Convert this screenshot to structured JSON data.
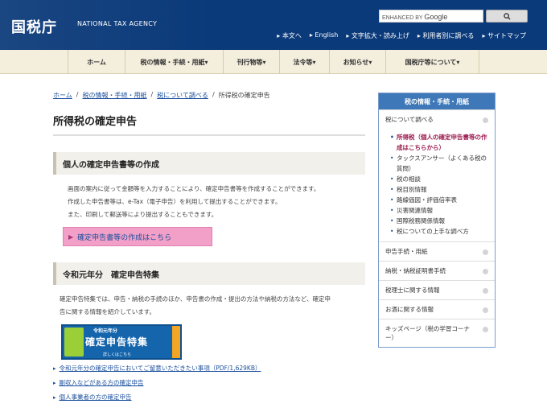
{
  "header": {
    "logo": "国税庁",
    "agency_en": "NATIONAL TAX AGENCY",
    "search_prefix": "ENHANCED BY",
    "search_brand": "Google",
    "util_links": [
      "本文へ",
      "English",
      "文字拡大・読み上げ",
      "利用者別に調べる",
      "サイトマップ"
    ]
  },
  "nav": {
    "items": [
      "ホーム",
      "税の情報・手続・用紙",
      "刊行物等",
      "法令等",
      "お知らせ",
      "国税庁等について"
    ]
  },
  "breadcrumb": [
    "ホーム",
    "税の情報・手続・用紙",
    "税について調べる",
    "所得税の確定申告"
  ],
  "main": {
    "title": "所得税の確定申告",
    "section1": {
      "heading": "個人の確定申告書等の作成",
      "lines": [
        "画面の案内に従って金額等を入力することにより、確定申告書等を作成することができます。",
        "作成した申告書等は、e-Tax（電子申告）を利用して提出することができます。",
        "また、印刷して郵送等により提出することもできます。"
      ],
      "button": "確定申告書等の作成はこちら"
    },
    "section2": {
      "heading": "令和元年分　確定申告特集",
      "lines": [
        "確定申告特集では、申告・納税の手続のほか、申告書の作成・提出の方法や納税の方法など、確定申",
        "告に関する情報を紹介しています。"
      ],
      "banner": {
        "sub": "令和元年分",
        "main": "確定申告特集",
        "more": "詳しくはこちら"
      },
      "links": [
        "令和元年分の確定申告においてご留意いただきたい事項（PDF/1,629KB）",
        "副収入などがある方の確定申告",
        "個人事業者の方の確定申告"
      ]
    }
  },
  "sidebar": {
    "heading": "税の情報・手続・用紙",
    "top_item": "税について調べる",
    "sub_items": [
      "所得税（個人の確定申告書等の作成はこちらから）",
      "タックスアンサー（よくある税の質問）",
      "税の相談",
      "税目別情報",
      "路線価図・評価倍率表",
      "災害関連情報",
      "国際税務関係情報",
      "税についての上手な調べ方"
    ],
    "items": [
      "申告手続・用紙",
      "納税・納税証明書手続",
      "税理士に関する情報",
      "お酒に関する情報",
      "キッズページ（税の学習コーナー）"
    ]
  },
  "colors": {
    "header": "#0b3a7a",
    "nav_bg": "#f4eedd",
    "sidebar_head": "#3e78b8",
    "button_pink": "#f3a0c8",
    "link": "#1a4f9c"
  }
}
